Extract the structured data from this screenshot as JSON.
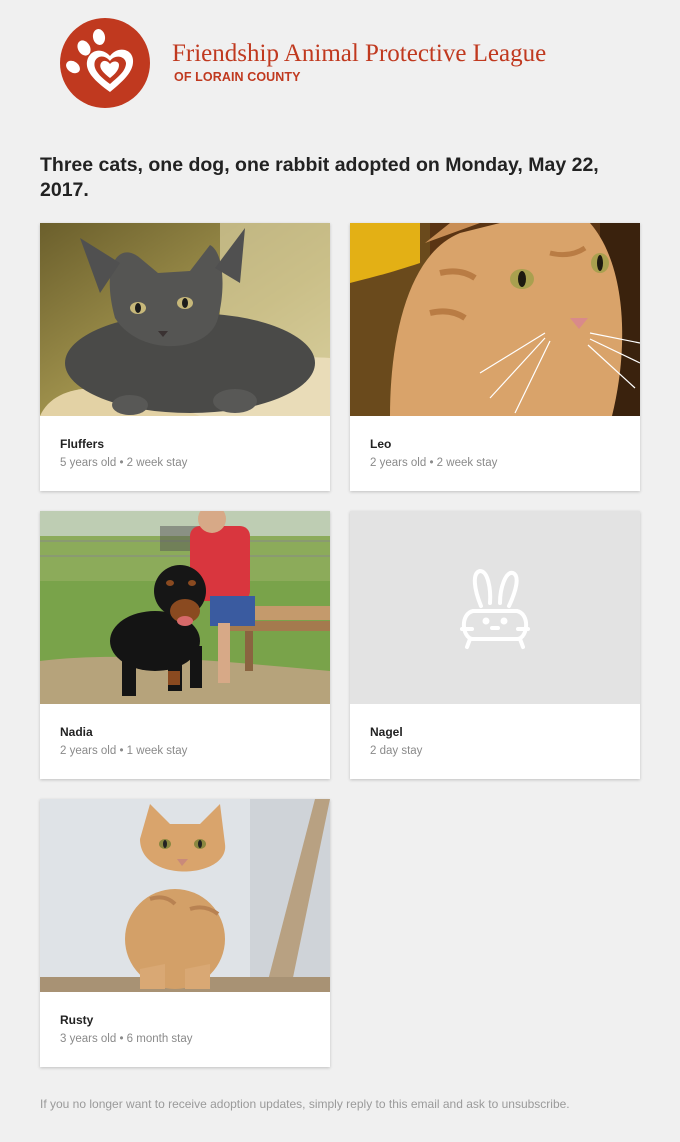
{
  "org": {
    "name": "Friendship Animal Protective League",
    "subtitle": "OF LORAIN COUNTY",
    "logo_icon": "paw-heart-icon",
    "brand_color": "#c0391f"
  },
  "headline": "Three cats, one dog, one rabbit adopted on Monday, May 22, 2017.",
  "pets": [
    {
      "name": "Fluffers",
      "meta": "5 years old • 2 week stay",
      "photo": "gray-cat-photo"
    },
    {
      "name": "Leo",
      "meta": "2 years old • 2 week stay",
      "photo": "orange-tabby-cat-photo"
    },
    {
      "name": "Nadia",
      "meta": "2 years old • 1 week stay",
      "photo": "rottweiler-dog-photo"
    },
    {
      "name": "Nagel",
      "meta": "2 day stay",
      "photo": "rabbit-placeholder-icon"
    },
    {
      "name": "Rusty",
      "meta": "3 years old • 6 month stay",
      "photo": "orange-cat-sitting-photo"
    }
  ],
  "footer": "If you no longer want to receive adoption updates, simply reply to this email and ask to unsubscribe."
}
